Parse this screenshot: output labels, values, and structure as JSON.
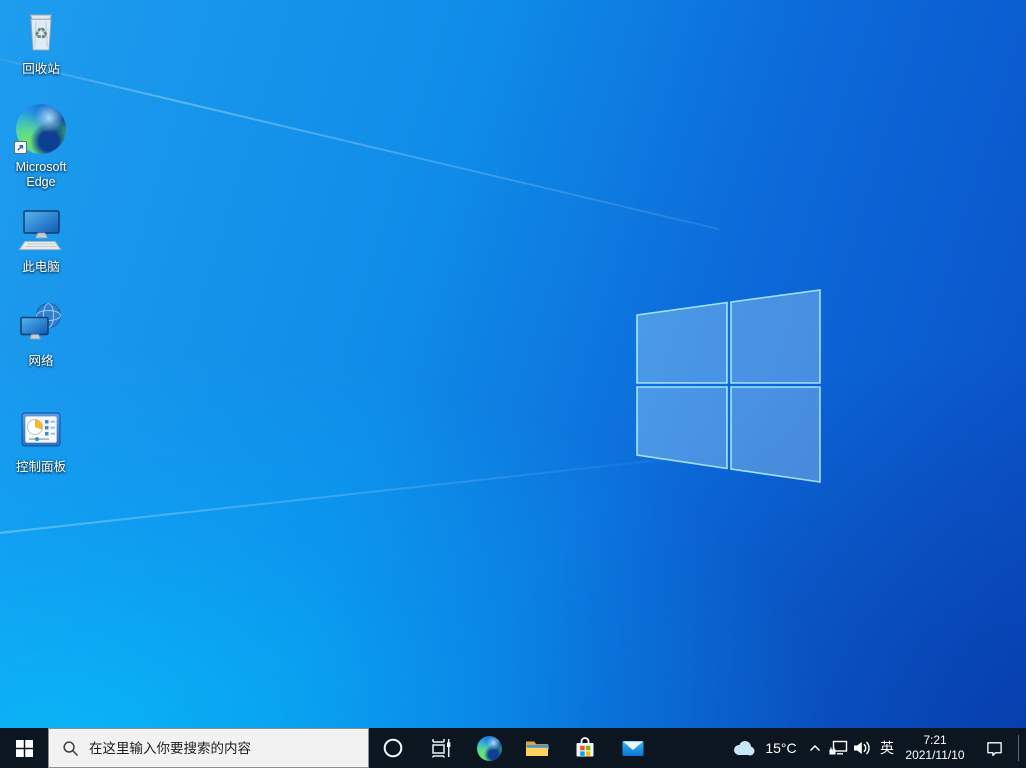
{
  "desktop": {
    "icons": [
      {
        "id": "recycle-bin",
        "label": "回收站"
      },
      {
        "id": "microsoft-edge",
        "label": "Microsoft Edge"
      },
      {
        "id": "this-pc",
        "label": "此电脑"
      },
      {
        "id": "network",
        "label": "网络"
      },
      {
        "id": "control-panel",
        "label": "控制面板"
      }
    ],
    "wallpaper_logo": "windows-logo"
  },
  "taskbar": {
    "search": {
      "placeholder": "在这里输入你要搜索的内容"
    },
    "tray": {
      "temperature": "15°C",
      "ime_indicator": "英",
      "time": "7:21",
      "date": "2021/11/10"
    }
  },
  "colors": {
    "wallpaper_azure": "#1193ea",
    "wallpaper_cyan": "#00a9f0",
    "wallpaper_deep_blue": "#0a4fc6",
    "logo_pane_stroke": "#bdf4ff",
    "taskbar_bg": "#0c1620",
    "search_box_bg": "#f2f2f2",
    "search_text": "#191919",
    "tray_text": "#ffffff"
  }
}
